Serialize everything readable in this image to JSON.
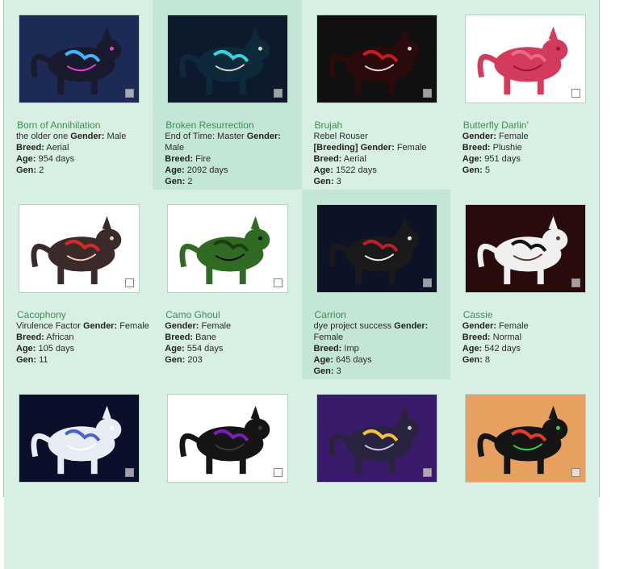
{
  "labels": {
    "gender": "Gender:",
    "breed": "Breed:",
    "age": "Age:",
    "gen": "Gen:"
  },
  "pets": [
    {
      "name": "Born of Annihilation",
      "title": "the older one",
      "gender": "Male",
      "breed": "Aerial",
      "age": "954 days",
      "gen": "2",
      "bg": "#1c2a55",
      "body": "#1a1a2e",
      "accent": "#3db6ff",
      "accent2": "#e043c8"
    },
    {
      "name": "Broken Resurrection",
      "title": "End of Time: Master",
      "gender": "Male",
      "breed": "Fire",
      "age": "2092 days",
      "gen": "2",
      "bg": "#0c1a2b",
      "body": "#0e2a3a",
      "accent": "#35d4e0",
      "accent2": "#d9d3c0"
    },
    {
      "name": "Brujah",
      "title": "Rebel Rouser",
      "title_bold": "[Breeding]",
      "gender": "Female",
      "breed": "Aerial",
      "age": "1522 days",
      "gen": "3",
      "bg": "#101010",
      "body": "#2a0a0a",
      "accent": "#c21d1d",
      "accent2": "#d9d9d9"
    },
    {
      "name": "Butterfly Darlin'",
      "title": "",
      "gender": "Female",
      "breed": "Plushie",
      "age": "951 days",
      "gen": "5",
      "bg": "#ffffff",
      "body": "#d33a5c",
      "accent": "#e96b8a",
      "accent2": "#9b1236"
    },
    {
      "name": "Cacophony",
      "title": "Virulence Factor",
      "gender": "Female",
      "breed": "African",
      "age": "105 days",
      "gen": "11",
      "bg": "#ffffff",
      "body": "#3b2a2a",
      "accent": "#d62828",
      "accent2": "#f2c7b5"
    },
    {
      "name": "Camo Ghoul",
      "title": "",
      "gender": "Female",
      "breed": "Bane",
      "age": "554 days",
      "gen": "203",
      "bg": "#ffffff",
      "body": "#2f6b22",
      "accent": "#1a3d12",
      "accent2": "#0d0d0d"
    },
    {
      "name": "Carrion",
      "title": "dye project success",
      "gender": "Female",
      "breed": "Imp",
      "age": "645 days",
      "gen": "3",
      "bg": "#0d1326",
      "body": "#1a1a1a",
      "accent": "#c01d2a",
      "accent2": "#ececec"
    },
    {
      "name": "Cassie",
      "title": "",
      "gender": "Female",
      "breed": "Normal",
      "age": "542 days",
      "gen": "8",
      "bg": "#2a0b0b",
      "body": "#f0f0f0",
      "accent": "#111111",
      "accent2": "#5a3a2a"
    },
    {
      "name": "",
      "title": "",
      "gender": "",
      "breed": "",
      "age": "",
      "gen": "",
      "bg": "#0a0f2a",
      "body": "#e8ecf5",
      "accent": "#4a63c9",
      "accent2": "#ffffff"
    },
    {
      "name": "",
      "title": "",
      "gender": "",
      "breed": "",
      "age": "",
      "gen": "",
      "bg": "#ffffff",
      "body": "#151515",
      "accent": "#7a1fb5",
      "accent2": "#3a3a3a"
    },
    {
      "name": "",
      "title": "",
      "gender": "",
      "breed": "",
      "age": "",
      "gen": "",
      "bg": "#3a1a6a",
      "body": "#2a2340",
      "accent": "#f0c040",
      "accent2": "#c7c7e8"
    },
    {
      "name": "",
      "title": "",
      "gender": "",
      "breed": "",
      "age": "",
      "gen": "",
      "bg": "#e8a060",
      "body": "#151515",
      "accent": "#e33b2b",
      "accent2": "#3bd04a"
    }
  ]
}
